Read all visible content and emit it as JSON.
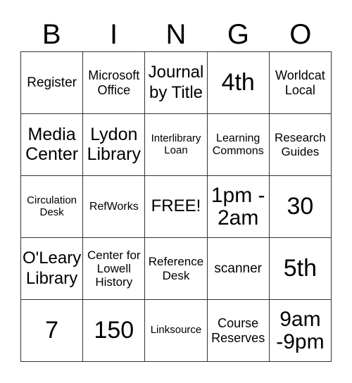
{
  "header": {
    "letters": [
      "B",
      "I",
      "N",
      "G",
      "O"
    ]
  },
  "board": {
    "rows": [
      [
        "Register",
        "Microsoft\nOffice",
        "Journal\nby Title",
        "4th",
        "Worldcat\nLocal"
      ],
      [
        "Media\nCenter",
        "Lydon\nLibrary",
        "Interlibrary\nLoan",
        "Learning\nCommons",
        "Research\nGuides"
      ],
      [
        "Circulation\nDesk",
        "RefWorks",
        "FREE!",
        "1pm -\n2am",
        "30"
      ],
      [
        "O'Leary\nLibrary",
        "Center for\nLowell\nHistory",
        "Reference\nDesk",
        "scanner",
        "5th"
      ],
      [
        "7",
        "150",
        "Linksource",
        "Course\nReserves",
        "9am\n-9pm"
      ]
    ]
  }
}
